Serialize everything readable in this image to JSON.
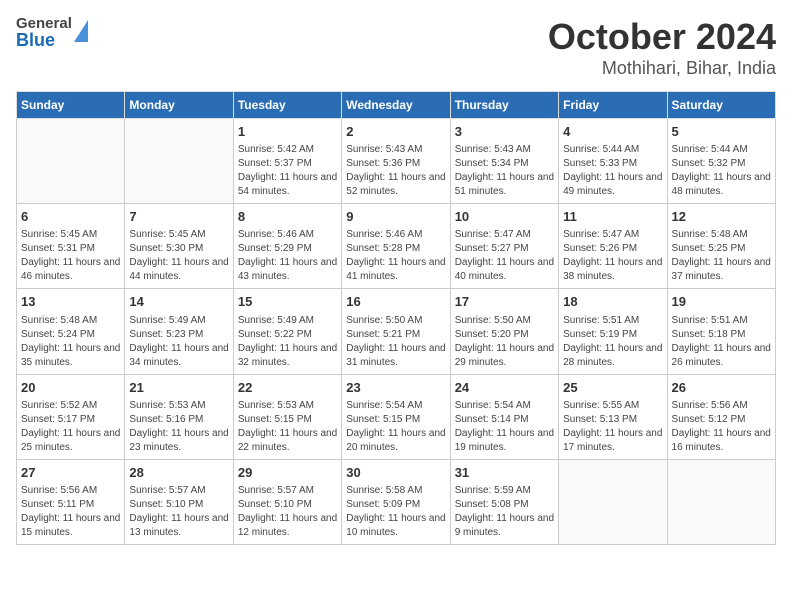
{
  "header": {
    "logo": {
      "general": "General",
      "blue": "Blue",
      "aria": "GeneralBlue logo"
    },
    "title": "October 2024",
    "subtitle": "Mothihari, Bihar, India"
  },
  "weekdays": [
    "Sunday",
    "Monday",
    "Tuesday",
    "Wednesday",
    "Thursday",
    "Friday",
    "Saturday"
  ],
  "weeks": [
    [
      {
        "day": "",
        "info": ""
      },
      {
        "day": "",
        "info": ""
      },
      {
        "day": "1",
        "sunrise": "Sunrise: 5:42 AM",
        "sunset": "Sunset: 5:37 PM",
        "daylight": "Daylight: 11 hours and 54 minutes."
      },
      {
        "day": "2",
        "sunrise": "Sunrise: 5:43 AM",
        "sunset": "Sunset: 5:36 PM",
        "daylight": "Daylight: 11 hours and 52 minutes."
      },
      {
        "day": "3",
        "sunrise": "Sunrise: 5:43 AM",
        "sunset": "Sunset: 5:34 PM",
        "daylight": "Daylight: 11 hours and 51 minutes."
      },
      {
        "day": "4",
        "sunrise": "Sunrise: 5:44 AM",
        "sunset": "Sunset: 5:33 PM",
        "daylight": "Daylight: 11 hours and 49 minutes."
      },
      {
        "day": "5",
        "sunrise": "Sunrise: 5:44 AM",
        "sunset": "Sunset: 5:32 PM",
        "daylight": "Daylight: 11 hours and 48 minutes."
      }
    ],
    [
      {
        "day": "6",
        "sunrise": "Sunrise: 5:45 AM",
        "sunset": "Sunset: 5:31 PM",
        "daylight": "Daylight: 11 hours and 46 minutes."
      },
      {
        "day": "7",
        "sunrise": "Sunrise: 5:45 AM",
        "sunset": "Sunset: 5:30 PM",
        "daylight": "Daylight: 11 hours and 44 minutes."
      },
      {
        "day": "8",
        "sunrise": "Sunrise: 5:46 AM",
        "sunset": "Sunset: 5:29 PM",
        "daylight": "Daylight: 11 hours and 43 minutes."
      },
      {
        "day": "9",
        "sunrise": "Sunrise: 5:46 AM",
        "sunset": "Sunset: 5:28 PM",
        "daylight": "Daylight: 11 hours and 41 minutes."
      },
      {
        "day": "10",
        "sunrise": "Sunrise: 5:47 AM",
        "sunset": "Sunset: 5:27 PM",
        "daylight": "Daylight: 11 hours and 40 minutes."
      },
      {
        "day": "11",
        "sunrise": "Sunrise: 5:47 AM",
        "sunset": "Sunset: 5:26 PM",
        "daylight": "Daylight: 11 hours and 38 minutes."
      },
      {
        "day": "12",
        "sunrise": "Sunrise: 5:48 AM",
        "sunset": "Sunset: 5:25 PM",
        "daylight": "Daylight: 11 hours and 37 minutes."
      }
    ],
    [
      {
        "day": "13",
        "sunrise": "Sunrise: 5:48 AM",
        "sunset": "Sunset: 5:24 PM",
        "daylight": "Daylight: 11 hours and 35 minutes."
      },
      {
        "day": "14",
        "sunrise": "Sunrise: 5:49 AM",
        "sunset": "Sunset: 5:23 PM",
        "daylight": "Daylight: 11 hours and 34 minutes."
      },
      {
        "day": "15",
        "sunrise": "Sunrise: 5:49 AM",
        "sunset": "Sunset: 5:22 PM",
        "daylight": "Daylight: 11 hours and 32 minutes."
      },
      {
        "day": "16",
        "sunrise": "Sunrise: 5:50 AM",
        "sunset": "Sunset: 5:21 PM",
        "daylight": "Daylight: 11 hours and 31 minutes."
      },
      {
        "day": "17",
        "sunrise": "Sunrise: 5:50 AM",
        "sunset": "Sunset: 5:20 PM",
        "daylight": "Daylight: 11 hours and 29 minutes."
      },
      {
        "day": "18",
        "sunrise": "Sunrise: 5:51 AM",
        "sunset": "Sunset: 5:19 PM",
        "daylight": "Daylight: 11 hours and 28 minutes."
      },
      {
        "day": "19",
        "sunrise": "Sunrise: 5:51 AM",
        "sunset": "Sunset: 5:18 PM",
        "daylight": "Daylight: 11 hours and 26 minutes."
      }
    ],
    [
      {
        "day": "20",
        "sunrise": "Sunrise: 5:52 AM",
        "sunset": "Sunset: 5:17 PM",
        "daylight": "Daylight: 11 hours and 25 minutes."
      },
      {
        "day": "21",
        "sunrise": "Sunrise: 5:53 AM",
        "sunset": "Sunset: 5:16 PM",
        "daylight": "Daylight: 11 hours and 23 minutes."
      },
      {
        "day": "22",
        "sunrise": "Sunrise: 5:53 AM",
        "sunset": "Sunset: 5:15 PM",
        "daylight": "Daylight: 11 hours and 22 minutes."
      },
      {
        "day": "23",
        "sunrise": "Sunrise: 5:54 AM",
        "sunset": "Sunset: 5:15 PM",
        "daylight": "Daylight: 11 hours and 20 minutes."
      },
      {
        "day": "24",
        "sunrise": "Sunrise: 5:54 AM",
        "sunset": "Sunset: 5:14 PM",
        "daylight": "Daylight: 11 hours and 19 minutes."
      },
      {
        "day": "25",
        "sunrise": "Sunrise: 5:55 AM",
        "sunset": "Sunset: 5:13 PM",
        "daylight": "Daylight: 11 hours and 17 minutes."
      },
      {
        "day": "26",
        "sunrise": "Sunrise: 5:56 AM",
        "sunset": "Sunset: 5:12 PM",
        "daylight": "Daylight: 11 hours and 16 minutes."
      }
    ],
    [
      {
        "day": "27",
        "sunrise": "Sunrise: 5:56 AM",
        "sunset": "Sunset: 5:11 PM",
        "daylight": "Daylight: 11 hours and 15 minutes."
      },
      {
        "day": "28",
        "sunrise": "Sunrise: 5:57 AM",
        "sunset": "Sunset: 5:10 PM",
        "daylight": "Daylight: 11 hours and 13 minutes."
      },
      {
        "day": "29",
        "sunrise": "Sunrise: 5:57 AM",
        "sunset": "Sunset: 5:10 PM",
        "daylight": "Daylight: 11 hours and 12 minutes."
      },
      {
        "day": "30",
        "sunrise": "Sunrise: 5:58 AM",
        "sunset": "Sunset: 5:09 PM",
        "daylight": "Daylight: 11 hours and 10 minutes."
      },
      {
        "day": "31",
        "sunrise": "Sunrise: 5:59 AM",
        "sunset": "Sunset: 5:08 PM",
        "daylight": "Daylight: 11 hours and 9 minutes."
      },
      {
        "day": "",
        "info": ""
      },
      {
        "day": "",
        "info": ""
      }
    ]
  ]
}
